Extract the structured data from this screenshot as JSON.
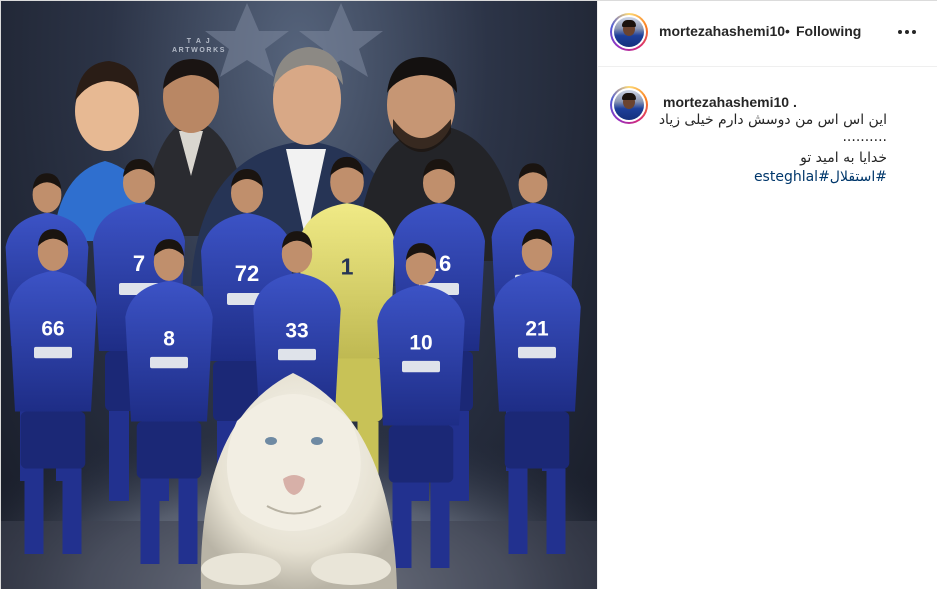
{
  "post": {
    "author_username": "mortezahashemi10",
    "follow_separator": "•",
    "follow_status": "Following",
    "caption": {
      "username": "mortezahashemi10",
      "username_suffix": ".",
      "line1": "این اس اس من دوسش دارم خیلی زیاد",
      "line2": "..........",
      "line3": "خدایا به امید تو",
      "hashtags": "#استقلال#esteghlal"
    }
  },
  "image": {
    "watermark": "T A J\nARTWORKS",
    "jersey_numbers": [
      "7",
      "72",
      "1",
      "16",
      "66",
      "8",
      "33",
      "10",
      "21"
    ],
    "kit_color": "#2c3fa8",
    "goalkeeper_kit_color": "#dcd66a"
  },
  "icons": {
    "more_options": "more-horizontal-icon",
    "profile_picture": "avatar-icon"
  },
  "colors": {
    "text": "#262626",
    "hashtag": "#00376b",
    "divider": "#efefef"
  }
}
